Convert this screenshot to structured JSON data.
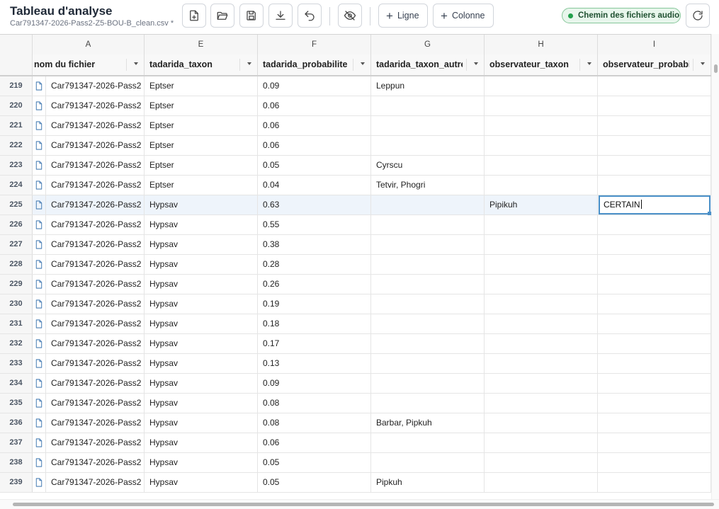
{
  "app": {
    "title": "Tableau d'analyse",
    "filename": "Car791347-2026-Pass2-Z5-BOU-B_clean.csv *"
  },
  "toolbar": {
    "icons": [
      "new-file-icon",
      "open-folder-icon",
      "save-icon",
      "download-icon",
      "undo-icon",
      "hide-columns-icon",
      "refresh-icon"
    ],
    "add_row_label": "Ligne",
    "add_column_label": "Colonne",
    "audio_path_label": "Chemin des fichiers audio",
    "audio_path_status_color": "#22a04b"
  },
  "columns": {
    "letters": {
      "A": "A",
      "E": "E",
      "F": "F",
      "G": "G",
      "H": "H",
      "I": "I"
    },
    "headers": {
      "A": "nom du fichier",
      "E": "tadarida_taxon",
      "F": "tadarida_probabilite",
      "G": "tadarida_taxon_autre",
      "H": "observateur_taxon",
      "I": "observateur_probabi"
    }
  },
  "rows": [
    {
      "n": "219",
      "file": "Car791347-2026-Pass2",
      "taxon": "Eptser",
      "prob": "0.09",
      "autre": "Leppun",
      "obs": "",
      "obsprob": ""
    },
    {
      "n": "220",
      "file": "Car791347-2026-Pass2",
      "taxon": "Eptser",
      "prob": "0.06",
      "autre": "",
      "obs": "",
      "obsprob": ""
    },
    {
      "n": "221",
      "file": "Car791347-2026-Pass2",
      "taxon": "Eptser",
      "prob": "0.06",
      "autre": "",
      "obs": "",
      "obsprob": ""
    },
    {
      "n": "222",
      "file": "Car791347-2026-Pass2",
      "taxon": "Eptser",
      "prob": "0.06",
      "autre": "",
      "obs": "",
      "obsprob": ""
    },
    {
      "n": "223",
      "file": "Car791347-2026-Pass2",
      "taxon": "Eptser",
      "prob": "0.05",
      "autre": "Cyrscu",
      "obs": "",
      "obsprob": ""
    },
    {
      "n": "224",
      "file": "Car791347-2026-Pass2",
      "taxon": "Eptser",
      "prob": "0.04",
      "autre": "Tetvir, Phogri",
      "obs": "",
      "obsprob": ""
    },
    {
      "n": "225",
      "file": "Car791347-2026-Pass2",
      "taxon": "Hypsav",
      "prob": "0.63",
      "autre": "",
      "obs": "Pipikuh",
      "obsprob": "CERTAIN",
      "selected": true
    },
    {
      "n": "226",
      "file": "Car791347-2026-Pass2",
      "taxon": "Hypsav",
      "prob": "0.55",
      "autre": "",
      "obs": "",
      "obsprob": ""
    },
    {
      "n": "227",
      "file": "Car791347-2026-Pass2",
      "taxon": "Hypsav",
      "prob": "0.38",
      "autre": "",
      "obs": "",
      "obsprob": ""
    },
    {
      "n": "228",
      "file": "Car791347-2026-Pass2",
      "taxon": "Hypsav",
      "prob": "0.28",
      "autre": "",
      "obs": "",
      "obsprob": ""
    },
    {
      "n": "229",
      "file": "Car791347-2026-Pass2",
      "taxon": "Hypsav",
      "prob": "0.26",
      "autre": "",
      "obs": "",
      "obsprob": ""
    },
    {
      "n": "230",
      "file": "Car791347-2026-Pass2",
      "taxon": "Hypsav",
      "prob": "0.19",
      "autre": "",
      "obs": "",
      "obsprob": ""
    },
    {
      "n": "231",
      "file": "Car791347-2026-Pass2",
      "taxon": "Hypsav",
      "prob": "0.18",
      "autre": "",
      "obs": "",
      "obsprob": ""
    },
    {
      "n": "232",
      "file": "Car791347-2026-Pass2",
      "taxon": "Hypsav",
      "prob": "0.17",
      "autre": "",
      "obs": "",
      "obsprob": ""
    },
    {
      "n": "233",
      "file": "Car791347-2026-Pass2",
      "taxon": "Hypsav",
      "prob": "0.13",
      "autre": "",
      "obs": "",
      "obsprob": ""
    },
    {
      "n": "234",
      "file": "Car791347-2026-Pass2",
      "taxon": "Hypsav",
      "prob": "0.09",
      "autre": "",
      "obs": "",
      "obsprob": ""
    },
    {
      "n": "235",
      "file": "Car791347-2026-Pass2",
      "taxon": "Hypsav",
      "prob": "0.08",
      "autre": "",
      "obs": "",
      "obsprob": ""
    },
    {
      "n": "236",
      "file": "Car791347-2026-Pass2",
      "taxon": "Hypsav",
      "prob": "0.08",
      "autre": "Barbar, Pipkuh",
      "obs": "",
      "obsprob": ""
    },
    {
      "n": "237",
      "file": "Car791347-2026-Pass2",
      "taxon": "Hypsav",
      "prob": "0.06",
      "autre": "",
      "obs": "",
      "obsprob": ""
    },
    {
      "n": "238",
      "file": "Car791347-2026-Pass2",
      "taxon": "Hypsav",
      "prob": "0.05",
      "autre": "",
      "obs": "",
      "obsprob": ""
    },
    {
      "n": "239",
      "file": "Car791347-2026-Pass2",
      "taxon": "Hypsav",
      "prob": "0.05",
      "autre": "Pipkuh",
      "obs": "",
      "obsprob": ""
    }
  ]
}
